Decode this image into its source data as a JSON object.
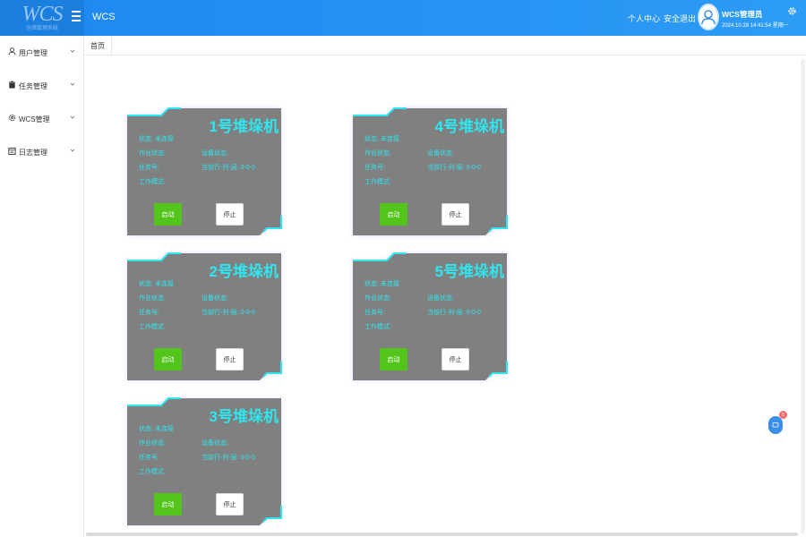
{
  "header": {
    "logo_text": "WCS",
    "logo_sub": "仓储管理系统",
    "app_title": "WCS",
    "personal_center": "个人中心",
    "logout": "安全退出",
    "user_name": "WCS管理员",
    "datetime": "2024.10.28 14:41:54 星期一"
  },
  "sidebar": {
    "items": [
      {
        "label": "用户管理",
        "icon": "user-icon"
      },
      {
        "label": "任务管理",
        "icon": "clipboard-icon"
      },
      {
        "label": "WCS管理",
        "icon": "settings-icon"
      },
      {
        "label": "日志管理",
        "icon": "calendar-icon"
      }
    ]
  },
  "tabs": [
    {
      "label": "首页"
    }
  ],
  "cards": [
    {
      "title": "1号堆垛机",
      "status_label": "状态:",
      "status_value": "未连接",
      "work_status_label": "作业状态:",
      "device_status_label": "设备状态:",
      "task_no_label": "任务号:",
      "position_label": "当前行-列-层:",
      "position_value": "0-0-0",
      "mode_label": "工作模式:",
      "start_label": "启动",
      "stop_label": "停止"
    },
    {
      "title": "4号堆垛机",
      "status_label": "状态:",
      "status_value": "未连接",
      "work_status_label": "作业状态:",
      "device_status_label": "设备状态:",
      "task_no_label": "任务号:",
      "position_label": "当前行-列-层:",
      "position_value": "0-0-0",
      "mode_label": "工作模式:",
      "start_label": "启动",
      "stop_label": "停止"
    },
    {
      "title": "2号堆垛机",
      "status_label": "状态:",
      "status_value": "未连接",
      "work_status_label": "作业状态:",
      "device_status_label": "设备状态:",
      "task_no_label": "任务号:",
      "position_label": "当前行-列-层:",
      "position_value": "0-0-0",
      "mode_label": "工作模式:",
      "start_label": "启动",
      "stop_label": "停止"
    },
    {
      "title": "5号堆垛机",
      "status_label": "状态:",
      "status_value": "未连接",
      "work_status_label": "作业状态:",
      "device_status_label": "设备状态:",
      "task_no_label": "任务号:",
      "position_label": "当前行-列-层:",
      "position_value": "0-0-0",
      "mode_label": "工作模式:",
      "start_label": "启动",
      "stop_label": "停止"
    },
    {
      "title": "3号堆垛机",
      "status_label": "状态:",
      "status_value": "未连接",
      "work_status_label": "作业状态:",
      "device_status_label": "设备状态:",
      "task_no_label": "任务号:",
      "position_label": "当前行-列-层:",
      "position_value": "0-0-0",
      "mode_label": "工作模式:",
      "start_label": "启动",
      "stop_label": "停止"
    }
  ],
  "float_badge": {
    "count": "0"
  },
  "colors": {
    "header": "#1e90ff",
    "card_bg": "#808080",
    "accent": "#2ee6f0",
    "start_button": "#52c41a",
    "glow": "#c9a7ff"
  }
}
